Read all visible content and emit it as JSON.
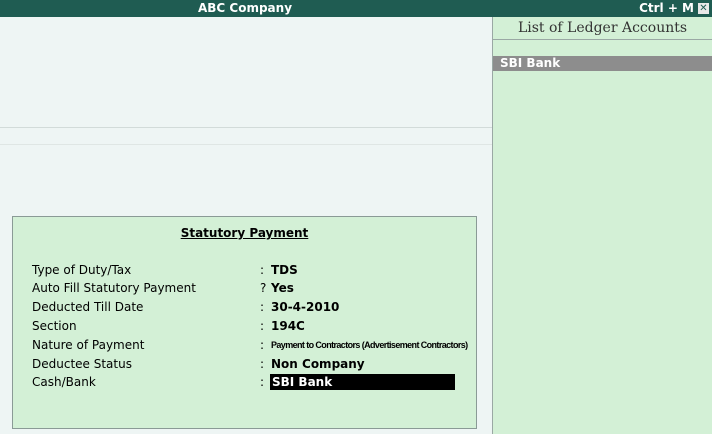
{
  "titlebar": {
    "title": "ABC Company",
    "shortcut": "Ctrl + M",
    "close_glyph": "✕"
  },
  "ledger_panel": {
    "heading": "List of Ledger Accounts",
    "items": [
      "SBI Bank"
    ]
  },
  "dialog": {
    "title": "Statutory Payment",
    "rows": [
      {
        "label": "Type of Duty/Tax",
        "separator": ":",
        "value": "TDS"
      },
      {
        "label": "Auto Fill Statutory Payment",
        "separator": "?",
        "value": "Yes"
      },
      {
        "label": "Deducted Till Date",
        "separator": ":",
        "value": "30-4-2010"
      },
      {
        "label": "Section",
        "separator": ":",
        "value": "194C"
      },
      {
        "label": "Nature of Payment",
        "separator": ":",
        "value": "Payment to Contractors (Advertisement Contractors)"
      },
      {
        "label": "Deductee Status",
        "separator": ":",
        "value": "Non Company"
      },
      {
        "label": "Cash/Bank",
        "separator": ":",
        "value": "SBI Bank"
      }
    ]
  },
  "colors": {
    "titlebar": "#1f5c52",
    "panel": "#d3f0d6",
    "highlight": "#8d8d8d",
    "background": "#eef5f4"
  }
}
